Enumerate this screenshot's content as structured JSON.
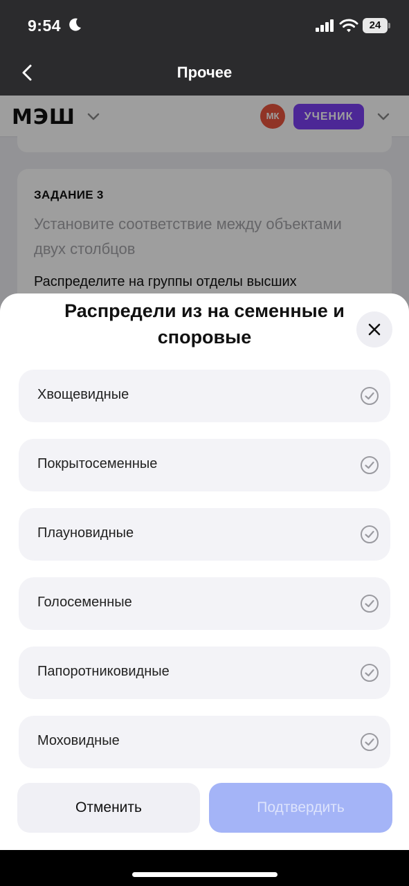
{
  "status_bar": {
    "time": "9:54",
    "battery": "24"
  },
  "nav": {
    "title": "Прочее"
  },
  "app_header": {
    "logo": "МЭШ",
    "avatar_initials": "МК",
    "role": "УЧЕНИК"
  },
  "task": {
    "label": "ЗАДАНИЕ 3",
    "subtitle": "Установите соответствие между объектами двух столбцов",
    "text": "Распределите на группы отделы высших"
  },
  "sheet": {
    "title": "Распредели из на семенные и споровые",
    "options": [
      {
        "label": "Хвощевидные"
      },
      {
        "label": "Покрытосеменные"
      },
      {
        "label": "Плауновидные"
      },
      {
        "label": "Голосеменные"
      },
      {
        "label": "Папоротниковидные"
      },
      {
        "label": "Моховидные"
      }
    ],
    "cancel_label": "Отменить",
    "confirm_label": "Подтвердить"
  },
  "colors": {
    "accent": "#7b3ff2",
    "avatar": "#e8553e",
    "confirm_disabled": "#a4b4f7",
    "option_bg": "#f3f3f7"
  }
}
